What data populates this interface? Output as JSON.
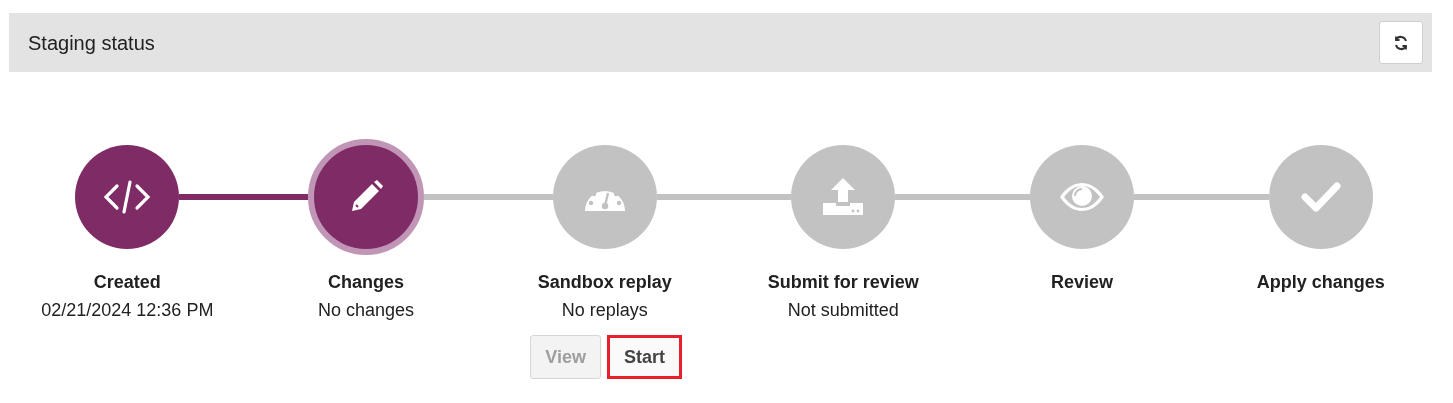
{
  "header": {
    "title": "Staging status"
  },
  "steps": [
    {
      "label": "Created",
      "detail": "02/21/2024 12:36 PM",
      "completed": true,
      "current": false
    },
    {
      "label": "Changes",
      "detail": "No changes",
      "completed": true,
      "current": true
    },
    {
      "label": "Sandbox replay",
      "detail": "No replays",
      "completed": false,
      "current": false,
      "actions": [
        {
          "label": "View",
          "disabled": true,
          "highlighted": false
        },
        {
          "label": "Start",
          "disabled": false,
          "highlighted": true
        }
      ]
    },
    {
      "label": "Submit for review",
      "detail": "Not submitted",
      "completed": false,
      "current": false
    },
    {
      "label": "Review",
      "completed": false,
      "current": false
    },
    {
      "label": "Apply changes",
      "completed": false,
      "current": false
    }
  ]
}
